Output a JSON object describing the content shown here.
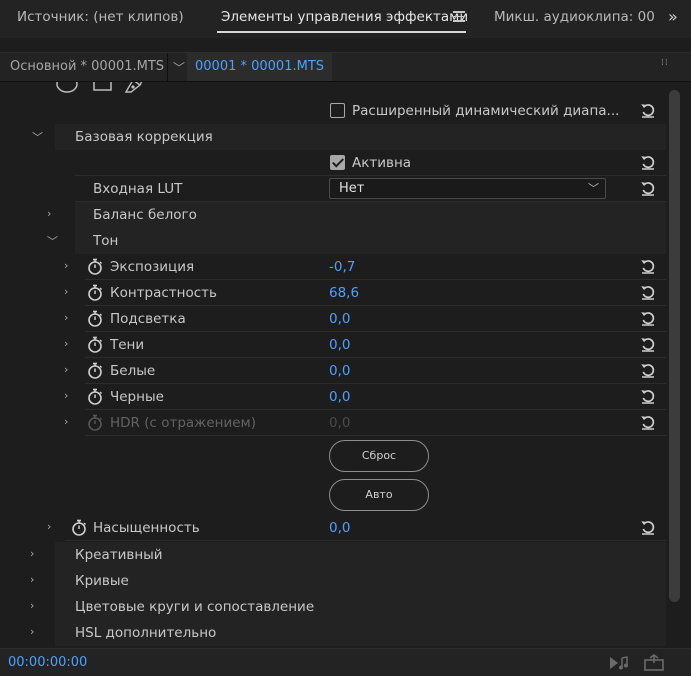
{
  "tabs": {
    "source": "Источник: (нет клипов)",
    "effect_controls": "Элементы управления эффектами",
    "audio_mixer": "Микш. аудиоклипа: 00"
  },
  "clip_bar": {
    "master": "Основной * 00001.MTS",
    "active": "00001 * 00001.MTS"
  },
  "rows": {
    "hdr_checkbox_label": "Расширенный динамический диапа...",
    "basic_correction": "Базовая коррекция",
    "active_label": "Активна",
    "input_lut_label": "Входная LUT",
    "input_lut_value": "Нет",
    "white_balance": "Баланс белого",
    "tone": "Тон",
    "exposure_label": "Экспозиция",
    "exposure_value": "-0,7",
    "contrast_label": "Контрастность",
    "contrast_value": "68,6",
    "highlights_label": "Подсветка",
    "highlights_value": "0,0",
    "shadows_label": "Тени",
    "shadows_value": "0,0",
    "whites_label": "Белые",
    "whites_value": "0,0",
    "blacks_label": "Черные",
    "blacks_value": "0,0",
    "hdr_specular_label": "HDR (с отражением)",
    "hdr_specular_value": "0,0",
    "reset_button": "Сброс",
    "auto_button": "Авто",
    "saturation_label": "Насыщенность",
    "saturation_value": "0,0",
    "creative": "Креативный",
    "curves": "Кривые",
    "color_wheels": "Цветовые круги и сопоставление",
    "hsl_secondary": "HSL дополнительно"
  },
  "status": {
    "timecode": "00:00:00:00"
  },
  "colors": {
    "accent_blue": "#4ea0ff",
    "panel_bg": "#1d1d1d",
    "row_bg": "#232323"
  },
  "icons": {
    "expand": "chevron-right-icon",
    "collapse": "chevron-down-icon",
    "reset": "reset-icon",
    "keyframe": "stopwatch-icon"
  }
}
